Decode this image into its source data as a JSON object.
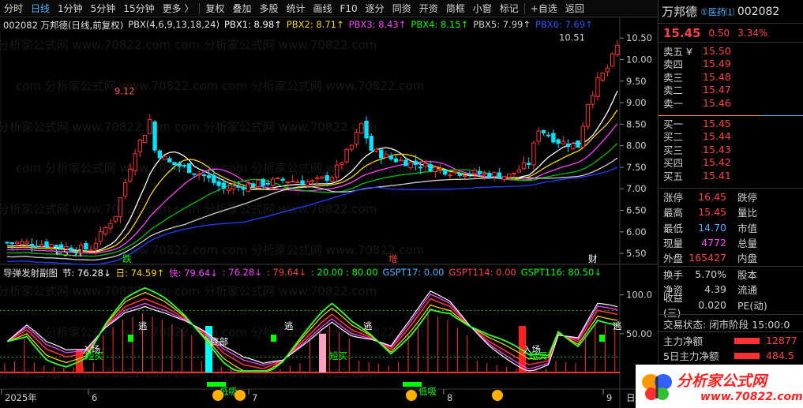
{
  "toolbar": {
    "items": [
      "分时",
      "日线",
      "1分钟",
      "5分钟",
      "15分钟",
      "更多 〉",
      "复权",
      "叠加",
      "多股",
      "统计",
      "画线",
      "F10",
      "逐分",
      "同资",
      "开资",
      "简框",
      "小窗",
      "标记",
      "+自选",
      "返回"
    ],
    "selected": "日线"
  },
  "main_header": {
    "title": "002082 万邦德(日线,前复权)",
    "indicator": "PBX(4,6,9,13,18,24)",
    "pbx": [
      {
        "label": "PBX1: 8.98",
        "color": "#ffffff",
        "arrow": "↑"
      },
      {
        "label": "PBX2: 8.71",
        "color": "#ffd700",
        "arrow": "↑"
      },
      {
        "label": "PBX3: 8.43",
        "color": "#ff40ff",
        "arrow": "↑"
      },
      {
        "label": "PBX4: 8.15",
        "color": "#00ff00",
        "arrow": "↑"
      },
      {
        "label": "PBX5: 7.99",
        "color": "#d0d0d0",
        "arrow": "↑"
      },
      {
        "label": "PBX6: 7.69",
        "color": "#3050ff",
        "arrow": "↑"
      }
    ]
  },
  "sub_header": {
    "title": "导弹发射副图",
    "values": [
      {
        "label": "节: 76.28",
        "color": "#ffffff",
        "arrow": "↓"
      },
      {
        "label": "日: 74.59",
        "color": "#ffd700",
        "arrow": "↑"
      },
      {
        "label": "快: 79.64",
        "color": "#ff40ff",
        "arrow": "↓"
      },
      {
        "label": ": 76.28",
        "color": "#ff40ff",
        "arrow": "↓"
      },
      {
        "label": ": 79.64",
        "color": "#ff4040",
        "arrow": "↓"
      },
      {
        "label": ": 20.00 : 80.00",
        "color": "#00ff00",
        "arrow": ""
      },
      {
        "label": "GSPT17: 0.00",
        "color": "#4db3ff",
        "arrow": ""
      },
      {
        "label": "GSPT114: 0.00",
        "color": "#ff4040",
        "arrow": ""
      },
      {
        "label": "GSPT116: 80.50",
        "color": "#00ff00",
        "arrow": "↓"
      }
    ]
  },
  "price_axis": [
    "10.50",
    "10.00",
    "9.50",
    "9.00",
    "8.50",
    "8.00",
    "7.50",
    "7.00",
    "6.50",
    "6.00",
    "5.50"
  ],
  "sub_axis": [
    "100.0",
    "50.00"
  ],
  "date_axis": [
    "2025年",
    "6",
    "7",
    "8",
    "9"
  ],
  "date_axis_right": "日",
  "annotations": {
    "high": "9.12",
    "low": "←5.51",
    "top_right": "10.51",
    "markers": [
      "跌",
      "增",
      "财"
    ],
    "sub": [
      "入场",
      "逃",
      "底部",
      "逃",
      "逃",
      "短买",
      "短买",
      "低吸",
      "低吸",
      "入场",
      "短买",
      "逃"
    ]
  },
  "watermark": "com 分析家公式网 www.70822.com",
  "quote": {
    "name": "万邦德",
    "tags": "①医药⑴",
    "code": "002082",
    "price": "15.45",
    "change": "0.50",
    "pct": "3.34%",
    "orderbook_sell": [
      {
        "label": "卖五 ¥",
        "price": "15.50"
      },
      {
        "label": "卖四",
        "price": "15.49"
      },
      {
        "label": "卖三",
        "price": "15.48"
      },
      {
        "label": "卖二",
        "price": "15.47"
      },
      {
        "label": "卖一",
        "price": "15.46"
      }
    ],
    "orderbook_buy": [
      {
        "label": "买一",
        "price": "15.45"
      },
      {
        "label": "买二",
        "price": "15.44"
      },
      {
        "label": "买三",
        "price": "15.43"
      },
      {
        "label": "买四",
        "price": "15.42"
      },
      {
        "label": "买五",
        "price": "15.41"
      }
    ],
    "stats": [
      {
        "l": "涨停",
        "v": "16.45",
        "c": "#ff4040",
        "l2": "跌停"
      },
      {
        "l": "最高",
        "v": "15.45",
        "c": "#ff4040",
        "l2": "量比"
      },
      {
        "l": "最低",
        "v": "14.70",
        "c": "#4db3ff",
        "l2": "市值"
      },
      {
        "l": "现量",
        "v": "4772",
        "c": "#ff40ff",
        "l2": "总量"
      },
      {
        "l": "外盘",
        "v": "165427",
        "c": "#ff4040",
        "l2": "内盘"
      }
    ],
    "stats2": [
      {
        "l": "换手",
        "v": "5.70%",
        "c": "#d0d0d0",
        "l2": "股本"
      },
      {
        "l": "净资",
        "v": "4.39",
        "c": "#d0d0d0",
        "l2": "流通"
      },
      {
        "l": "收益(三)",
        "v": "0.020",
        "c": "#d0d0d0",
        "l2": "PE(动)"
      }
    ],
    "trade_state": "交易状态: 闭市阶段 15:00:0",
    "net_flow": [
      {
        "l": "主力净额",
        "v": "12877"
      },
      {
        "l": "5日主力净额",
        "v": "484.5"
      }
    ]
  },
  "logo": {
    "text": "分析家公式网",
    "url": "www.70822.com"
  }
}
